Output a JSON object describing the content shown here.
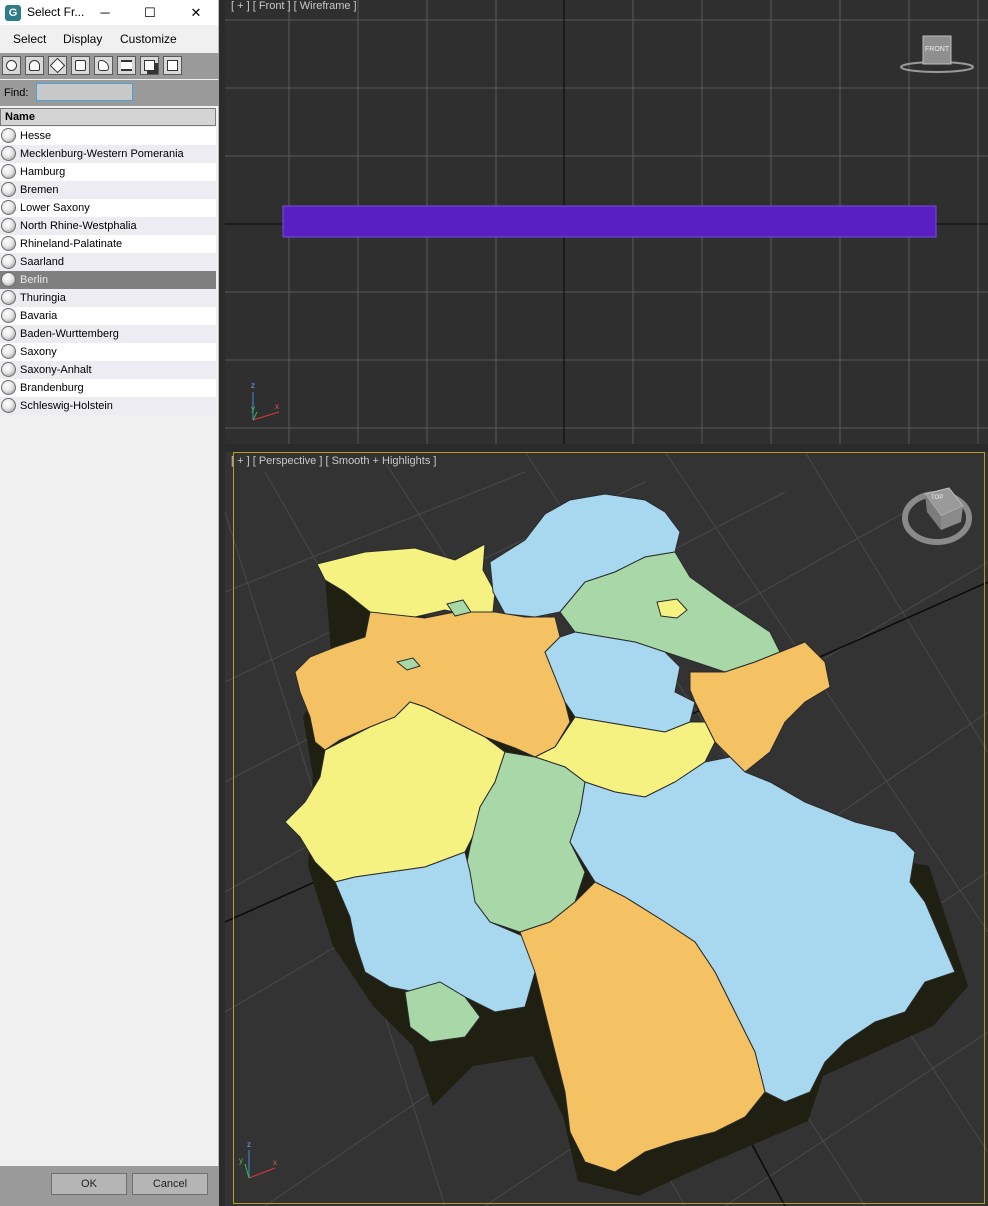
{
  "dialog": {
    "title": "Select Fr...",
    "app_icon_letter": "G",
    "window_controls": {
      "minimize": "─",
      "maximize": "☐",
      "close": "✕"
    },
    "menu": [
      "Select",
      "Display",
      "Customize"
    ],
    "find_label": "Find:",
    "find_value": "",
    "column_header": "Name",
    "items": [
      {
        "label": "Hesse",
        "selected": false
      },
      {
        "label": "Mecklenburg-Western Pomerania",
        "selected": false
      },
      {
        "label": "Hamburg",
        "selected": false
      },
      {
        "label": "Bremen",
        "selected": false
      },
      {
        "label": "Lower Saxony",
        "selected": false
      },
      {
        "label": "North Rhine-Westphalia",
        "selected": false
      },
      {
        "label": "Rhineland-Palatinate",
        "selected": false
      },
      {
        "label": "Saarland",
        "selected": false
      },
      {
        "label": "Berlin",
        "selected": true
      },
      {
        "label": "Thuringia",
        "selected": false
      },
      {
        "label": "Bavaria",
        "selected": false
      },
      {
        "label": "Baden-Wurttemberg",
        "selected": false
      },
      {
        "label": "Saxony",
        "selected": false
      },
      {
        "label": "Saxony-Anhalt",
        "selected": false
      },
      {
        "label": "Brandenburg",
        "selected": false
      },
      {
        "label": "Schleswig-Holstein",
        "selected": false
      }
    ],
    "ok_label": "OK",
    "cancel_label": "Cancel"
  },
  "viewports": {
    "front": {
      "label": "[ + ] [ Front ] [ Wireframe ]",
      "viewcube_label": "FRONT",
      "axis_z": "z",
      "axis_x": "x",
      "axis_y": "y"
    },
    "perspective": {
      "label": "[ + ] [ Perspective ] [ Smooth + Highlights ]",
      "viewcube_label": "TOP",
      "axis_z": "z",
      "axis_x": "x",
      "axis_y": "y"
    }
  },
  "colors": {
    "map_blue": "#a8d8f0",
    "map_green": "#a8d8a8",
    "map_yellow": "#f5f282",
    "map_orange": "#f5c263",
    "selection_purple": "#5a1fc2",
    "viewport_border_active": "#b89b2a"
  },
  "icons": [
    "app-icon",
    "display-all-icon",
    "geometry-icon",
    "light-icon",
    "camera-icon",
    "helper-icon",
    "spacewarp-icon",
    "group-icon",
    "bone-icon",
    "object-sphere-icon"
  ]
}
